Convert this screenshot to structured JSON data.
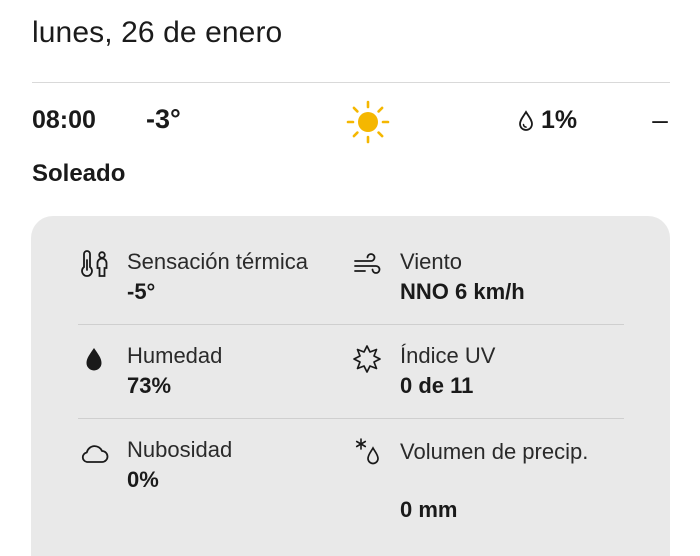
{
  "date_title": "lunes, 26 de enero",
  "hour": {
    "time": "08:00",
    "temperature": "-3°",
    "weather_icon": "sun-icon",
    "precip_probability": "1%",
    "collapse_symbol": "–"
  },
  "condition": "Soleado",
  "details": {
    "feels_like": {
      "label": "Sensación térmica",
      "value": "-5°",
      "icon": "thermometer-person-icon"
    },
    "wind": {
      "label": "Viento",
      "value": "NNO 6 km/h",
      "icon": "wind-icon"
    },
    "humidity": {
      "label": "Humedad",
      "value": "73%",
      "icon": "humidity-drop-icon"
    },
    "uv": {
      "label": "Índice UV",
      "value": "0 de 11",
      "icon": "uv-sun-icon"
    },
    "cloudiness": {
      "label": "Nubosidad",
      "value": "0%",
      "icon": "cloud-icon"
    },
    "precip_volume": {
      "label": "Volumen de precip.",
      "value": "0 mm",
      "icon": "precip-volume-icon"
    }
  },
  "colors": {
    "sun": "#F5B700",
    "card_background": "#E9E9E9",
    "text": "#1A1A1A"
  }
}
